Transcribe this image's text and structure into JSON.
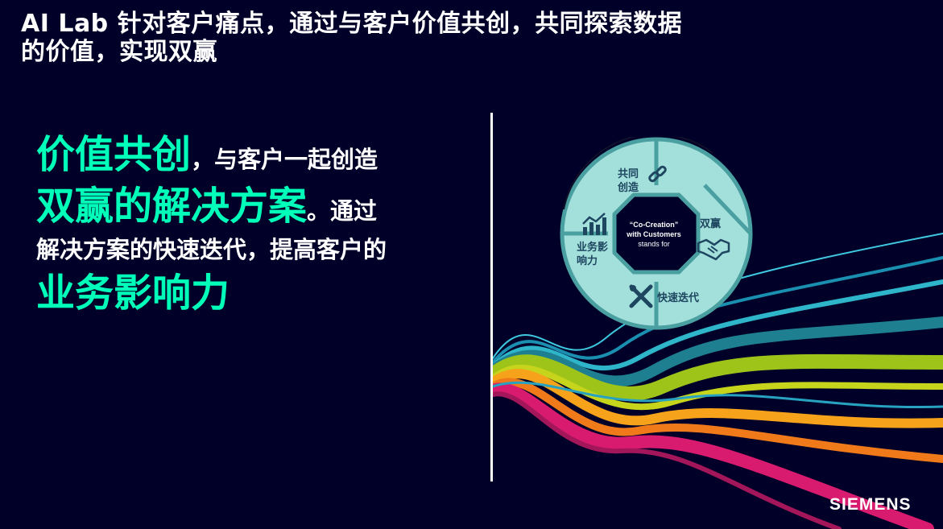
{
  "title": {
    "line1": "AI Lab 针对客户痛点，通过与客户价值共创，共同探索数据",
    "line2": "的价值，实现双赢"
  },
  "main": {
    "part1_big": "价值共创",
    "part1_small": "，与客户一起创造",
    "part2_big": "双赢的解决方案",
    "part2_small": "。通过",
    "part3": "解决方案的快速迭代，提高客户的",
    "part4_big": "业务影响力"
  },
  "wheel": {
    "segments": {
      "cocreate": "共同\n创造",
      "winwin": "双赢",
      "iterate": "快速迭代",
      "impact": "业务影\n响力"
    },
    "center": {
      "line1": "“Co-Creation”",
      "line2": "with Customers",
      "line3": "stands for"
    },
    "icons": [
      "link-icon",
      "handshake-icon",
      "tools-icon",
      "chart-icon"
    ]
  },
  "brand": {
    "logo": "SIEMENS"
  },
  "colors": {
    "background": "#000028",
    "accent": "#00ffb9",
    "wheel_fill": "#a3e0dc",
    "wheel_ring": "#4a9fa0",
    "wheel_center": "#000028"
  }
}
